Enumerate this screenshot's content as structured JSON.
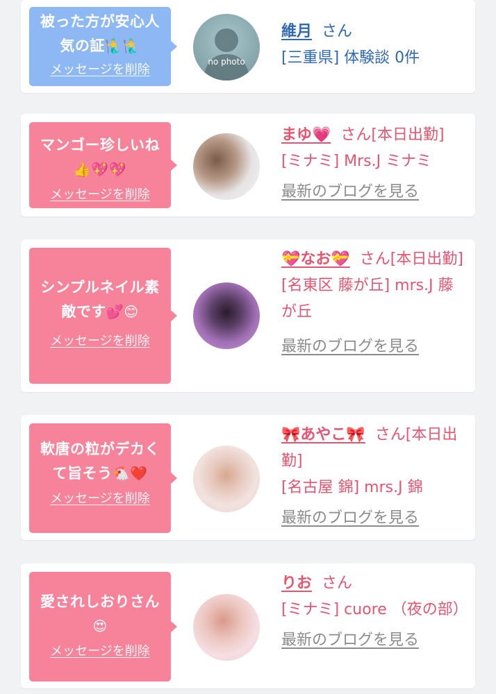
{
  "colors": {
    "blue_bubble": "#8db8f4",
    "pink_bubble": "#f7839b",
    "blue_text": "#2f68b3",
    "pink_text": "#e6546f",
    "gray_link": "#8b8b8b"
  },
  "cards": [
    {
      "message_text": "被った方が安心人気の証",
      "message_emoji": "🧜‍♂️🧜‍♂️",
      "delete_label": "メッセージを削除",
      "name": "維月",
      "suffix": "さん",
      "detail": "[三重県] 体験談 0件",
      "avatar_label": "no photo"
    },
    {
      "message_text": "マンゴー珍しいね",
      "message_emoji": "👍💖💖",
      "delete_label": "メッセージを削除",
      "name": "まゆ💗",
      "suffix": "さん[本日出勤]",
      "detail": "[ミナミ] Mrs.J ミナミ",
      "blog_link": "最新のブログを見る"
    },
    {
      "message_text": "シンプルネイル素敵です",
      "message_emoji": "💕😊",
      "delete_label": "メッセージを削除",
      "name": "💝なお💝",
      "suffix": "さん[本日出勤]",
      "detail": "[名東区 藤が丘] mrs.J 藤が丘",
      "blog_link": "最新のブログを見る"
    },
    {
      "message_text": "軟唐の粒がデカくて旨そう",
      "message_emoji": "🐔❤️",
      "delete_label": "メッセージを削除",
      "name": "🎀あやこ🎀",
      "suffix": "さん[本日出勤]",
      "detail": "[名古屋 錦] mrs.J 錦",
      "blog_link": "最新のブログを見る"
    },
    {
      "message_text": "愛されしおりさん",
      "message_emoji": "😍",
      "delete_label": "メッセージを削除",
      "name": "りお",
      "suffix": "さん",
      "detail": "[ミナミ] cuore （夜の部）",
      "blog_link": "最新のブログを見る"
    }
  ]
}
